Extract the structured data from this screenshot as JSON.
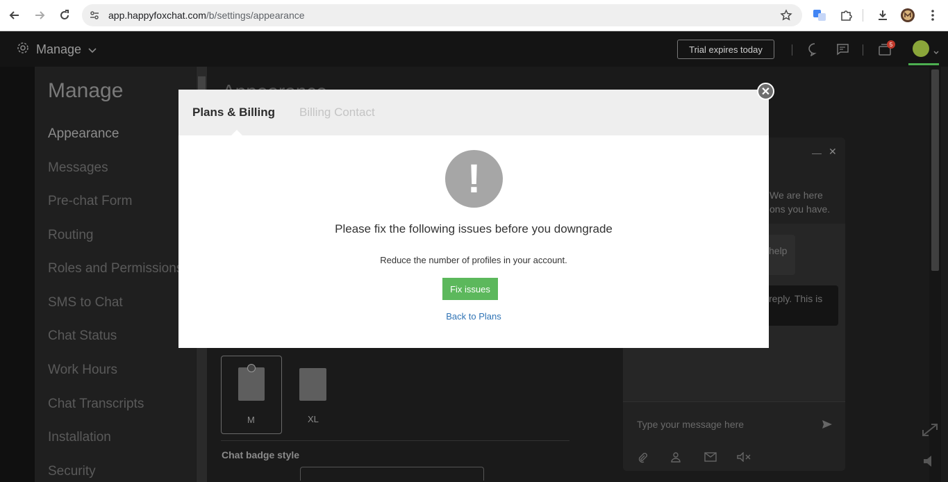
{
  "browser": {
    "url_host": "app.happyfoxchat.com",
    "url_path": "/b/settings/appearance"
  },
  "header": {
    "manage_label": "Manage",
    "trial_label": "Trial expires today",
    "notification_count": "5"
  },
  "sidebar": {
    "title": "Manage",
    "items": [
      {
        "label": "Appearance"
      },
      {
        "label": "Messages"
      },
      {
        "label": "Pre-chat Form"
      },
      {
        "label": "Routing"
      },
      {
        "label": "Roles and Permissions"
      },
      {
        "label": "SMS to Chat"
      },
      {
        "label": "Chat Status"
      },
      {
        "label": "Work Hours"
      },
      {
        "label": "Chat Transcripts"
      },
      {
        "label": "Installation"
      },
      {
        "label": "Security"
      }
    ]
  },
  "main": {
    "title": "Appearance",
    "size_m": "M",
    "size_xl": "XL",
    "chat_badge_style": "Chat badge style"
  },
  "widget": {
    "intro_line1": "We are here",
    "intro_line2": "ons you have.",
    "bubble1_text": "help",
    "bubble2_text": "reply. This is",
    "input_placeholder": "Type your message here"
  },
  "modal": {
    "tab_active": "Plans & Billing",
    "tab_inactive": "Billing Contact",
    "warn_glyph": "!",
    "heading": "Please fix the following issues before you downgrade",
    "message": "Reduce the number of profiles in your account.",
    "fix_button": "Fix issues",
    "back_link": "Back to Plans",
    "close_glyph": "✕"
  },
  "colors": {
    "accent_green": "#5cb85c",
    "link_blue": "#2f73b5"
  }
}
